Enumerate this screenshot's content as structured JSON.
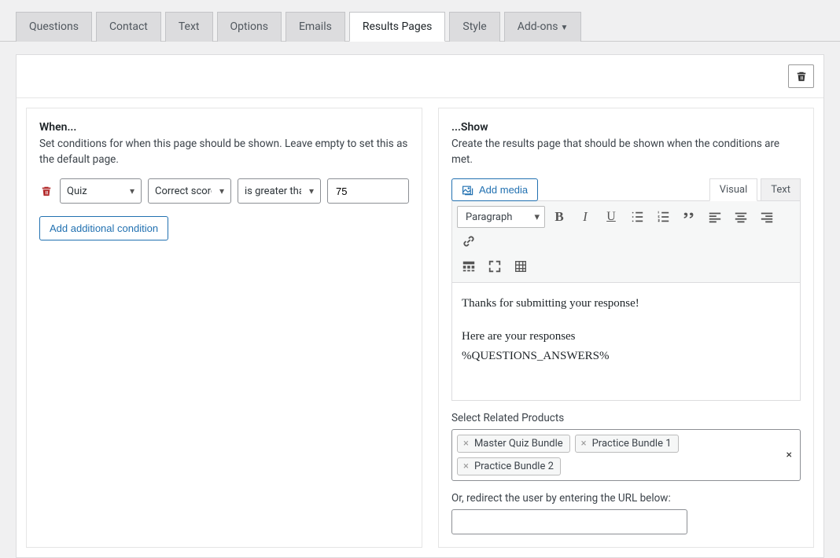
{
  "tabs": [
    "Questions",
    "Contact",
    "Text",
    "Options",
    "Emails",
    "Results Pages",
    "Style",
    "Add-ons"
  ],
  "active_tab": "Results Pages",
  "when": {
    "title": "When...",
    "desc": "Set conditions for when this page should be shown. Leave empty to set this as the default page.",
    "condition": {
      "subject": "Quiz",
      "metric": "Correct score",
      "operator": "is greater than",
      "value": "75"
    },
    "add_btn": "Add additional condition"
  },
  "show": {
    "title": "...Show",
    "desc": "Create the results page that should be shown when the conditions are met.",
    "add_media": "Add media",
    "editor_tabs": {
      "visual": "Visual",
      "text": "Text"
    },
    "format": "Paragraph",
    "content_line1": "Thanks for submitting your response!",
    "content_line2": "Here are your responses",
    "content_line3": "%QUESTIONS_ANSWERS%",
    "related_label": "Select Related Products",
    "related_products": [
      "Master Quiz Bundle",
      "Practice Bundle 1",
      "Practice Bundle 2"
    ],
    "redirect_label": "Or, redirect the user by entering the URL below:",
    "redirect_value": ""
  }
}
